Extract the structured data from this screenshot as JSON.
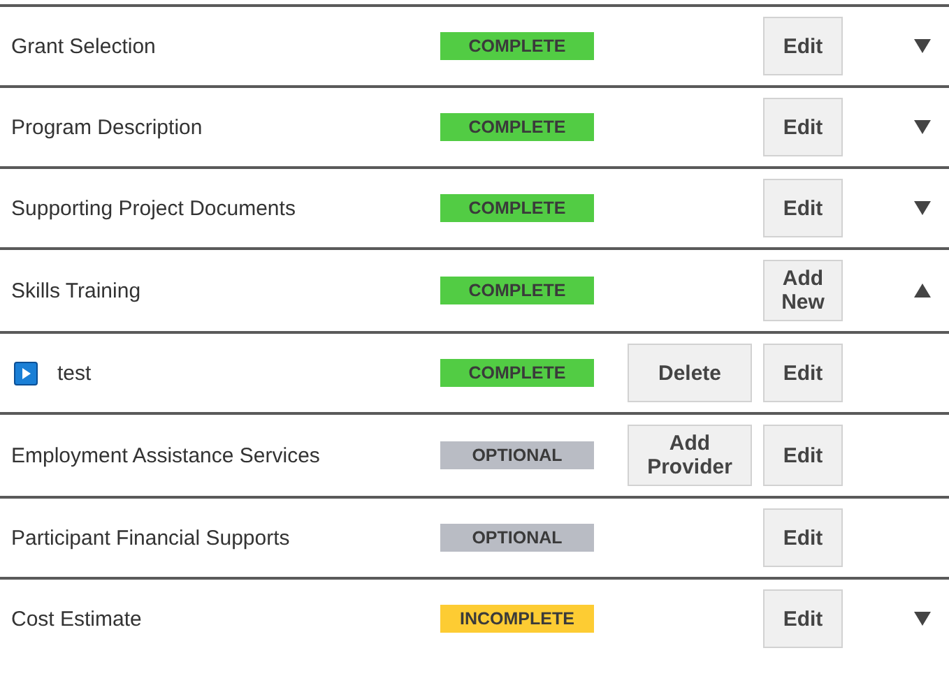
{
  "sections": [
    {
      "name": "Grant Selection",
      "status": {
        "kind": "complete",
        "label": "COMPLETE"
      },
      "actions": [
        "Edit"
      ],
      "expanded": false
    },
    {
      "name": "Program Description",
      "status": {
        "kind": "complete",
        "label": "COMPLETE"
      },
      "actions": [
        "Edit"
      ],
      "expanded": false
    },
    {
      "name": "Supporting Project Documents",
      "status": {
        "kind": "complete",
        "label": "COMPLETE"
      },
      "actions": [
        "Edit"
      ],
      "expanded": false
    },
    {
      "name": "Skills Training",
      "status": {
        "kind": "complete",
        "label": "COMPLETE"
      },
      "actions": [
        "Add New"
      ],
      "expanded": true,
      "children": [
        {
          "name": "test",
          "status": {
            "kind": "complete",
            "label": "COMPLETE"
          },
          "actions": [
            "Delete",
            "Edit"
          ]
        }
      ]
    },
    {
      "name": "Employment Assistance Services",
      "status": {
        "kind": "optional",
        "label": "OPTIONAL"
      },
      "actions": [
        "Add Provider",
        "Edit"
      ]
    },
    {
      "name": "Participant Financial Supports",
      "status": {
        "kind": "optional",
        "label": "OPTIONAL"
      },
      "actions": [
        "Edit"
      ]
    },
    {
      "name": "Cost Estimate",
      "status": {
        "kind": "incomplete",
        "label": "INCOMPLETE"
      },
      "actions": [
        "Edit"
      ],
      "expanded": false
    }
  ]
}
